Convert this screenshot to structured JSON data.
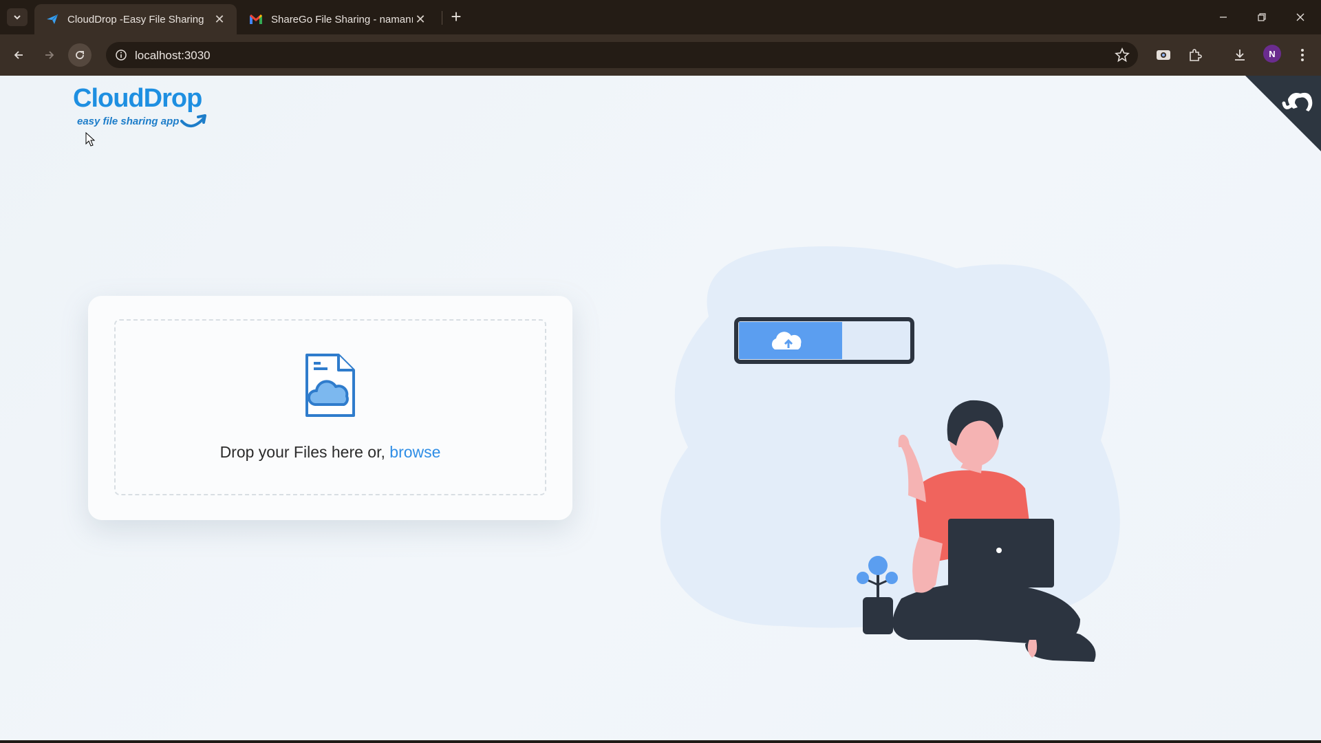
{
  "browser": {
    "tabs": [
      {
        "title": "CloudDrop -Easy File Sharing",
        "active": true,
        "favicon": "paper-plane-icon"
      },
      {
        "title": "ShareGo File Sharing - namanı",
        "active": false,
        "favicon": "gmail-icon"
      }
    ],
    "url": "localhost:3030",
    "profile_initial": "N"
  },
  "page": {
    "logo": {
      "name": "CloudDrop",
      "tagline": "easy file sharing app"
    },
    "dropzone": {
      "text": "Drop your Files here or, ",
      "browse_label": "browse"
    }
  },
  "colors": {
    "accent": "#2f8ee6",
    "logo_blue": "#1e8fe1",
    "shirt": "#f0645d",
    "progress_blue": "#5b9ef0"
  }
}
